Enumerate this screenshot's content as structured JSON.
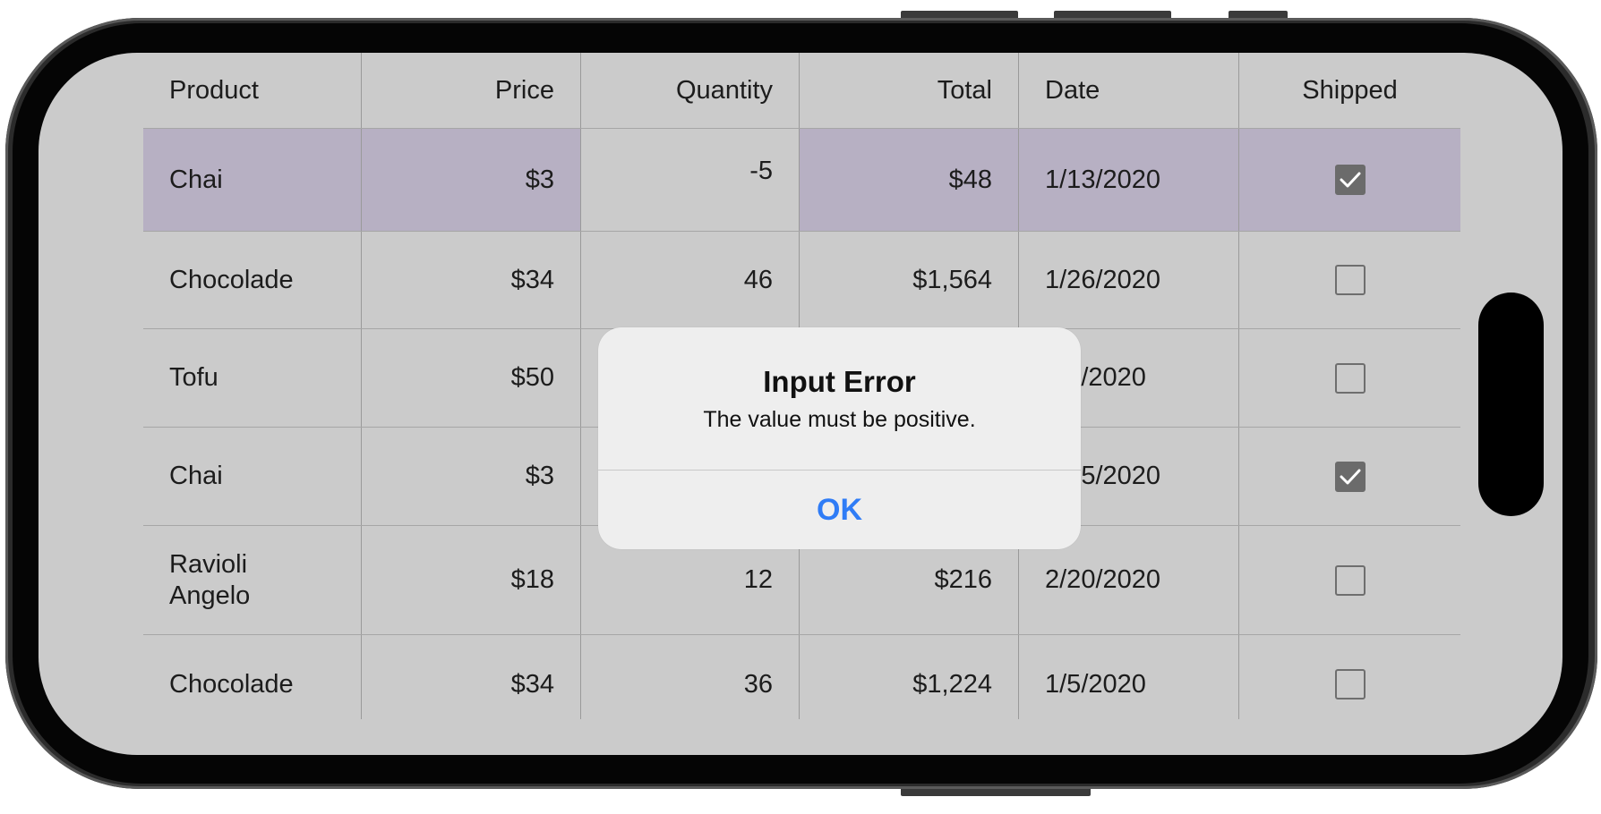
{
  "grid": {
    "headers": [
      "Product",
      "Price",
      "Quantity",
      "Total",
      "Date",
      "Shipped"
    ],
    "rows": [
      {
        "product": "Chai",
        "price": "$3",
        "quantity": "-5",
        "total": "$48",
        "date": "1/13/2020",
        "shipped": true,
        "selected": true
      },
      {
        "product": "Chocolade",
        "price": "$34",
        "quantity": "46",
        "total": "$1,564",
        "date": "1/26/2020",
        "shipped": false
      },
      {
        "product": "Tofu",
        "price": "$50",
        "quantity": "",
        "total": "",
        "date": "2/8/2020",
        "shipped": false
      },
      {
        "product": "Chai",
        "price": "$3",
        "quantity": "",
        "total": "",
        "date": "2/15/2020",
        "shipped": true
      },
      {
        "product": "Ravioli Angelo",
        "price": "$18",
        "quantity": "12",
        "total": "$216",
        "date": "2/20/2020",
        "shipped": false
      },
      {
        "product": "Chocolade",
        "price": "$34",
        "quantity": "36",
        "total": "$1,224",
        "date": "1/5/2020",
        "shipped": false
      }
    ]
  },
  "alert": {
    "title": "Input Error",
    "message": "The value must be positive.",
    "ok_label": "OK"
  },
  "colors": {
    "selected_row": "#b7b0c3",
    "grid_background": "#cbcbcb",
    "alert_button": "#2f7cf6"
  }
}
